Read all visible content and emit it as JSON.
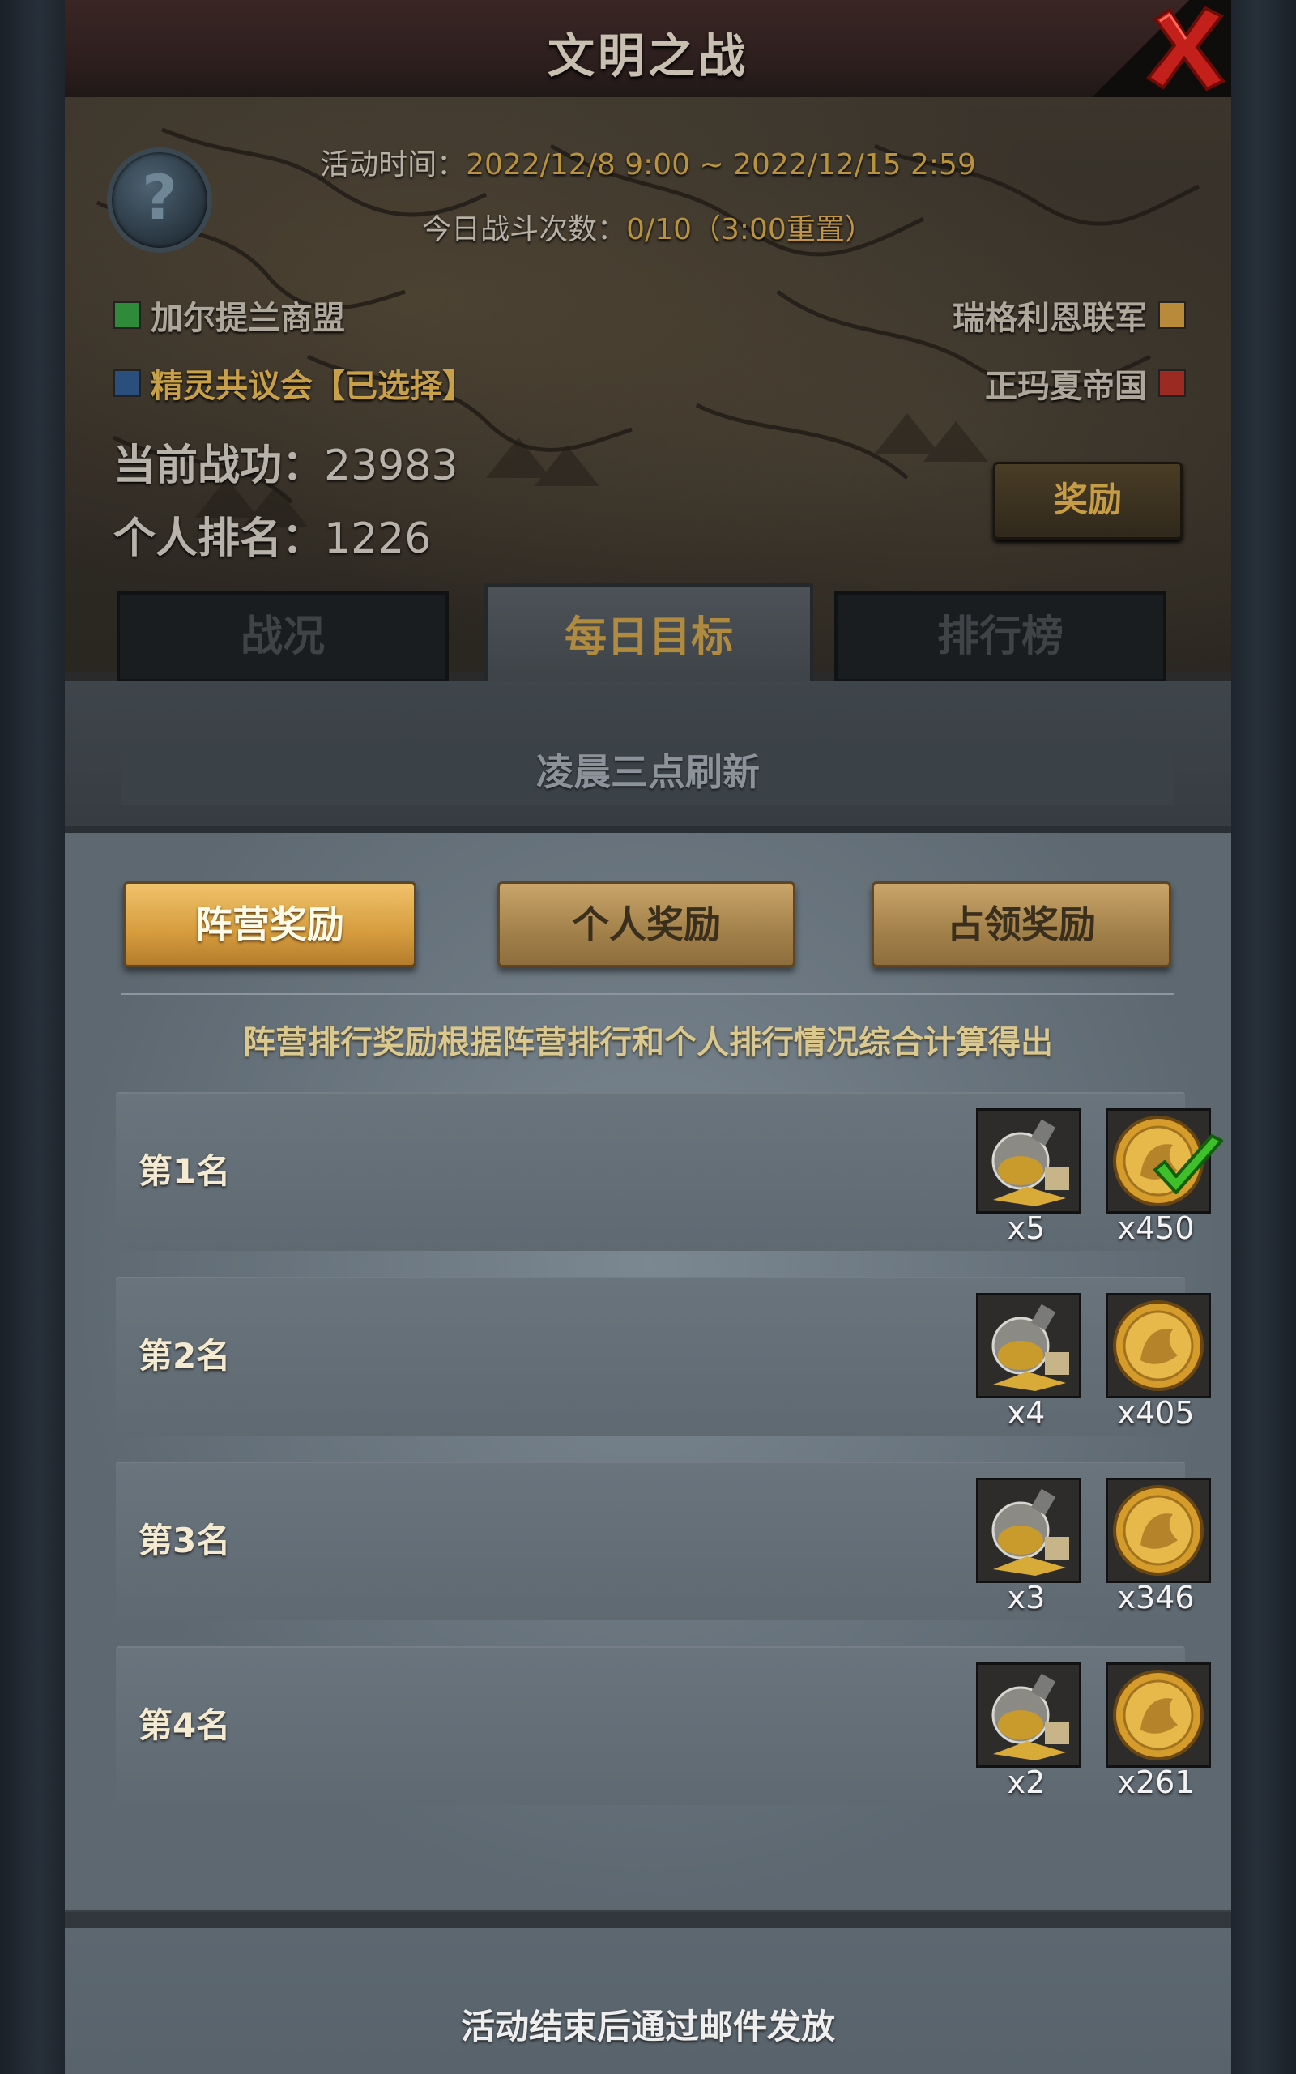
{
  "window": {
    "title": "文明之战"
  },
  "header": {
    "activity_time_label": "活动时间：",
    "activity_time_value": "2022/12/8 9:00 ~ 2022/12/15 2:59",
    "battles_label": "今日战斗次数：",
    "battles_value": "0/10（3:00",
    "battles_reset": "重置）",
    "factions": [
      {
        "name": "加尔提兰商盟",
        "color": "#2f8a3a"
      },
      {
        "name": "精灵共议会【已选择】",
        "color": "#2b4f7d",
        "selected": true
      },
      {
        "name": "瑞格利恩联军",
        "color": "#b88a3a"
      },
      {
        "name": "正玛夏帝国",
        "color": "#9a2a22"
      }
    ],
    "merit_label": "当前战功：",
    "merit_value": "23983",
    "rank_label": "个人排名：",
    "rank_value": "1226",
    "reward_button": "奖励"
  },
  "tabs": [
    {
      "label": "战况",
      "active": false
    },
    {
      "label": "每日目标",
      "active": true
    },
    {
      "label": "排行榜",
      "active": false
    }
  ],
  "refresh_note": "凌晨三点刷新",
  "subtabs": [
    {
      "label": "阵营奖励",
      "active": true
    },
    {
      "label": "个人奖励",
      "active": false
    },
    {
      "label": "占领奖励",
      "active": false
    }
  ],
  "description": "阵营排行奖励根据阵营排行和个人排行情况综合计算得出",
  "rows": [
    {
      "rank": "第1名",
      "potion_count": "x5",
      "coin_count": "x450",
      "claimed": true
    },
    {
      "rank": "第2名",
      "potion_count": "x4",
      "coin_count": "x405",
      "claimed": false
    },
    {
      "rank": "第3名",
      "potion_count": "x3",
      "coin_count": "x346",
      "claimed": false
    },
    {
      "rank": "第4名",
      "potion_count": "x2",
      "coin_count": "x261",
      "claimed": false
    }
  ],
  "footer": "活动结束后通过邮件发放",
  "icons": {
    "close": "close-x-icon",
    "help": "question-icon",
    "item1": "gold-potion-icon",
    "item2": "gold-coin-icon",
    "claimed": "checkmark-icon"
  }
}
